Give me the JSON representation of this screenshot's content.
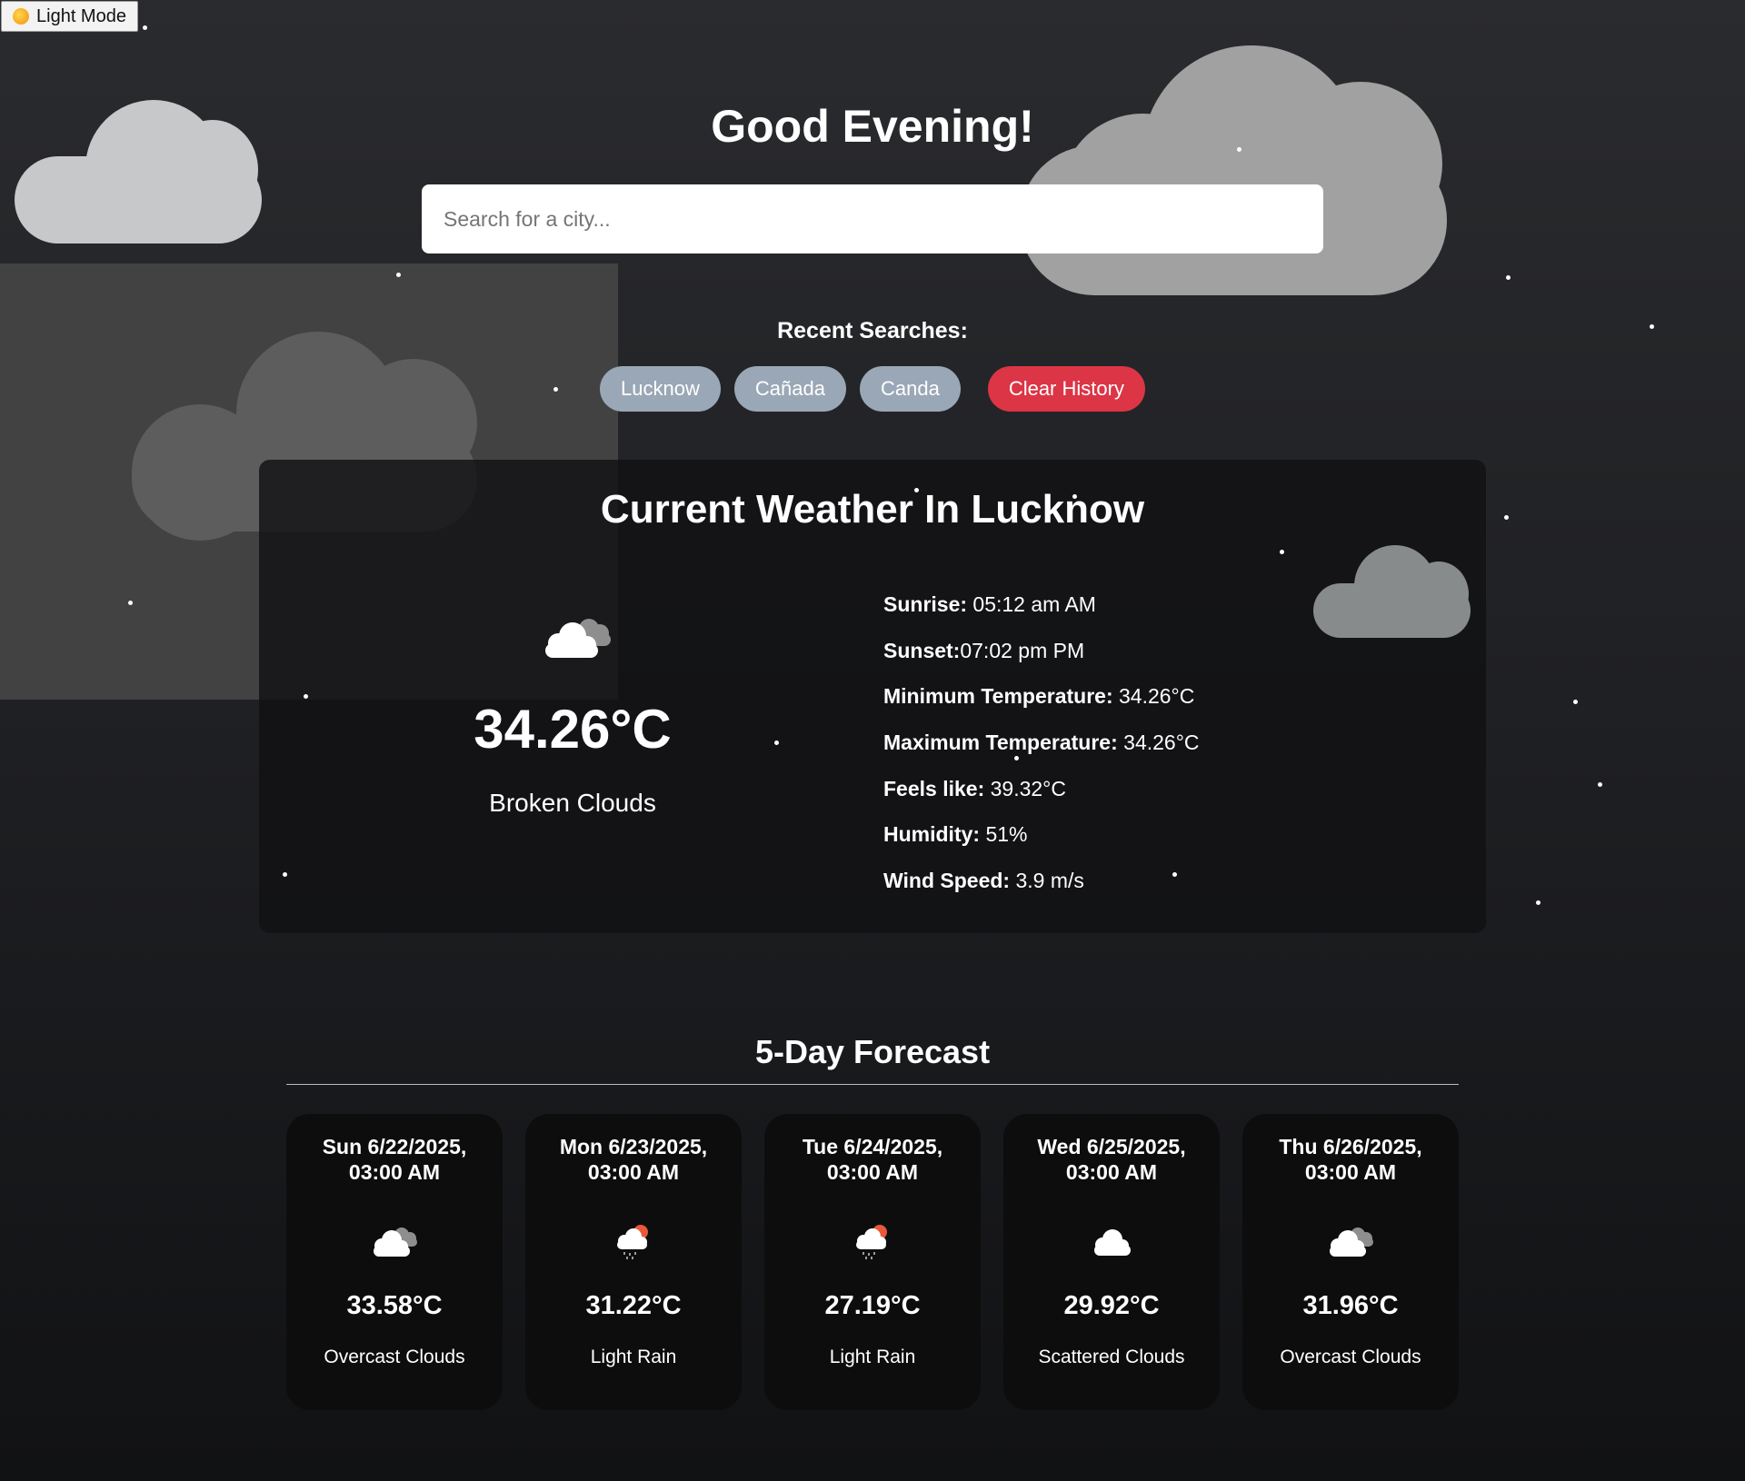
{
  "mode_toggle": {
    "label": "Light Mode",
    "icon": "sun-icon"
  },
  "greeting": "Good Evening!",
  "search": {
    "placeholder": "Search for a city...",
    "value": ""
  },
  "recent": {
    "title": "Recent Searches:",
    "items": [
      "Lucknow",
      "Cañada",
      "Canda"
    ],
    "clear_label": "Clear History"
  },
  "current": {
    "title": "Current Weather In Lucknow",
    "icon": "broken-clouds-icon",
    "temp": "34.26°C",
    "description": "Broken Clouds",
    "details": [
      {
        "label": "Sunrise:",
        "value": " 05:12 am AM"
      },
      {
        "label": "Sunset:",
        "value": "07:02 pm PM"
      },
      {
        "label": "Minimum Temperature:",
        "value": " 34.26°C"
      },
      {
        "label": "Maximum Temperature:",
        "value": " 34.26°C"
      },
      {
        "label": "Feels like:",
        "value": " 39.32°C"
      },
      {
        "label": "Humidity:",
        "value": " 51%"
      },
      {
        "label": "Wind Speed:",
        "value": " 3.9 m/s"
      }
    ]
  },
  "forecast": {
    "title": "5-Day Forecast",
    "days": [
      {
        "date": "Sun 6/22/2025, 03:00 AM",
        "icon": "overcast-clouds-icon",
        "temp": "33.58°C",
        "description": "Overcast Clouds"
      },
      {
        "date": "Mon 6/23/2025, 03:00 AM",
        "icon": "light-rain-icon",
        "temp": "31.22°C",
        "description": "Light Rain"
      },
      {
        "date": "Tue 6/24/2025, 03:00 AM",
        "icon": "light-rain-icon",
        "temp": "27.19°C",
        "description": "Light Rain"
      },
      {
        "date": "Wed 6/25/2025, 03:00 AM",
        "icon": "scattered-clouds-icon",
        "temp": "29.92°C",
        "description": "Scattered Clouds"
      },
      {
        "date": "Thu 6/26/2025, 03:00 AM",
        "icon": "overcast-clouds-icon",
        "temp": "31.96°C",
        "description": "Overcast Clouds"
      }
    ]
  },
  "colors": {
    "city_pill": "#9aa7b6",
    "clear_button": "#dc3545",
    "card_background": "#0d0d0e"
  }
}
